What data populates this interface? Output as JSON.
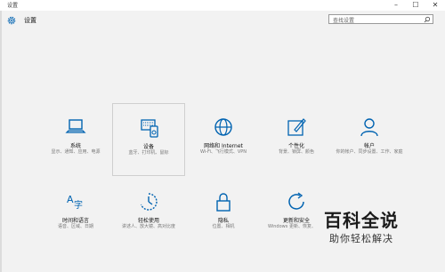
{
  "window": {
    "title": "设置",
    "minimize_icon": "minimize-icon",
    "maximize_icon": "maximize-icon",
    "close_icon": "close-icon"
  },
  "header": {
    "title": "设置",
    "icon": "gear-icon"
  },
  "search": {
    "placeholder": "查找设置",
    "icon": "search-icon"
  },
  "accent": "#0063b1",
  "tiles": [
    {
      "title": "系统",
      "subtitle": "显示、通知、应用、电源",
      "icon": "laptop-icon"
    },
    {
      "title": "设备",
      "subtitle": "蓝牙、打印机、鼠标",
      "icon": "keyboard-speaker-icon",
      "selected": true
    },
    {
      "title": "网络和 Internet",
      "subtitle": "Wi-Fi、飞行模式、VPN",
      "icon": "globe-icon"
    },
    {
      "title": "个性化",
      "subtitle": "背景、锁屏、颜色",
      "icon": "paint-icon"
    },
    {
      "title": "帐户",
      "subtitle": "你的帐户、同步设置、工作、家庭",
      "icon": "person-icon"
    },
    {
      "title": "时间和语言",
      "subtitle": "语音、区域、日期",
      "icon": "time-language-icon"
    },
    {
      "title": "轻松使用",
      "subtitle": "讲述人、放大镜、高对比度",
      "icon": "ease-of-access-icon"
    },
    {
      "title": "隐私",
      "subtitle": "位置、相机",
      "icon": "lock-icon"
    },
    {
      "title": "更新和安全",
      "subtitle": "Windows 更新、恢复、备份",
      "icon": "sync-icon"
    }
  ],
  "watermark": {
    "main": "百科全说",
    "sub": "助你轻松解决"
  }
}
